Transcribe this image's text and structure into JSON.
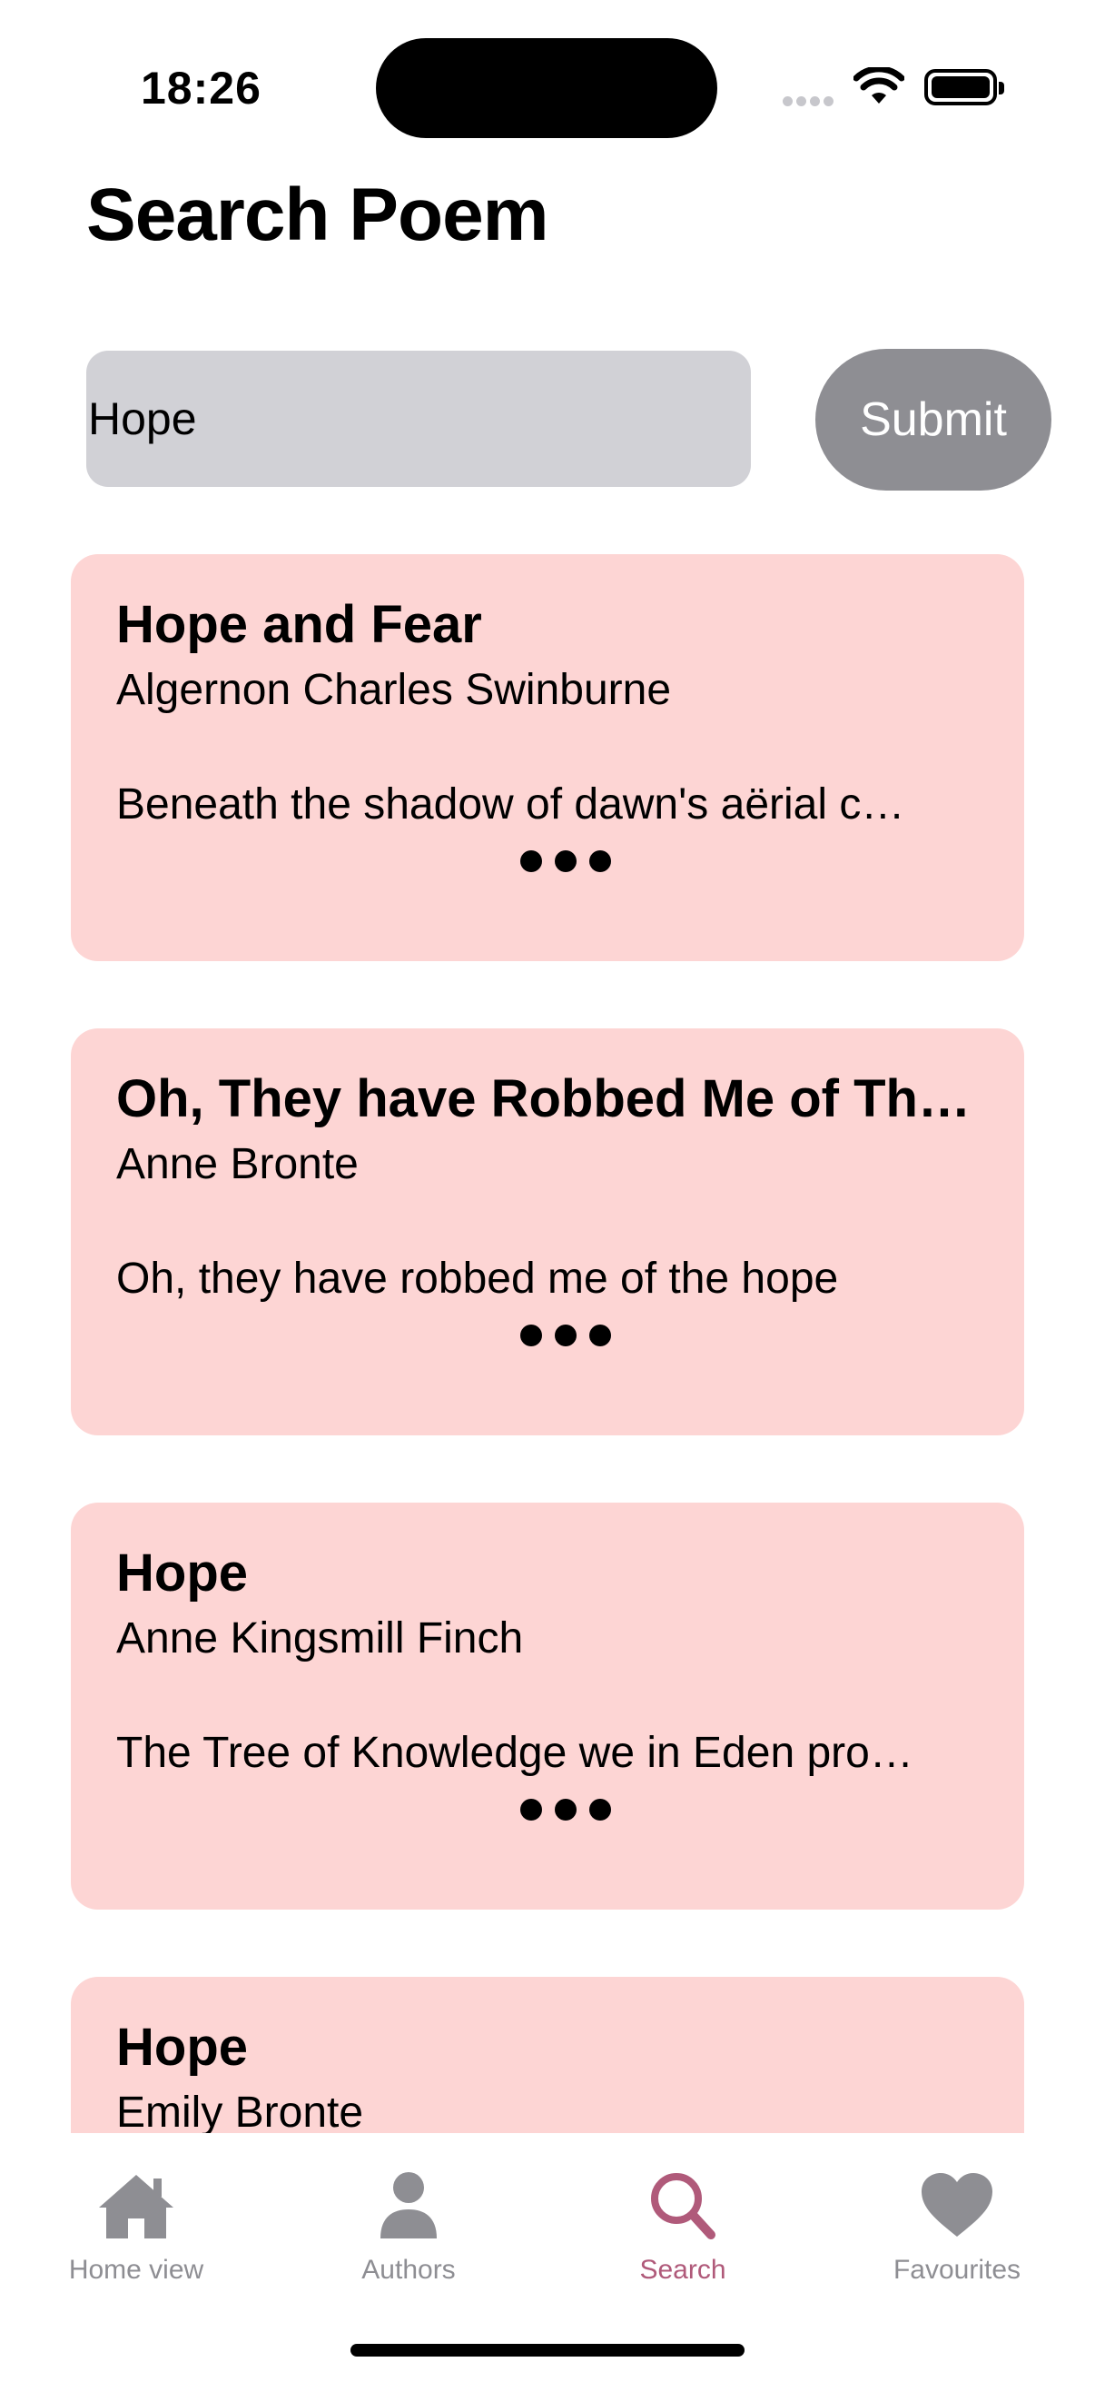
{
  "status_bar": {
    "time": "18:26"
  },
  "header": {
    "title": "Search Poem"
  },
  "search": {
    "value": "Hope",
    "submit_label": "Submit"
  },
  "results": [
    {
      "title": "Hope and Fear",
      "author": "Algernon Charles Swinburne",
      "first_line": "Beneath the shadow of dawn's aërial c…"
    },
    {
      "title": "Oh, They have Robbed Me of Th…",
      "author": "Anne Bronte",
      "first_line": "Oh, they have robbed me of the hope"
    },
    {
      "title": "Hope",
      "author": "Anne Kingsmill Finch",
      "first_line": "The Tree of Knowledge we in Eden pro…"
    },
    {
      "title": "Hope",
      "author": "Emily Bronte",
      "first_line": ""
    }
  ],
  "tab_bar": {
    "tabs": [
      {
        "label": "Home view",
        "icon": "house-icon"
      },
      {
        "label": "Authors",
        "icon": "person-icon"
      },
      {
        "label": "Search",
        "icon": "magnifier-icon",
        "active": true
      },
      {
        "label": "Favourites",
        "icon": "heart-icon"
      }
    ]
  },
  "colors": {
    "card_background": "#fdd5d4",
    "accent": "#b05a7a",
    "inactive_tab": "#8e8e93",
    "input_background": "#d1d1d6",
    "submit_background": "#8e8e93"
  }
}
